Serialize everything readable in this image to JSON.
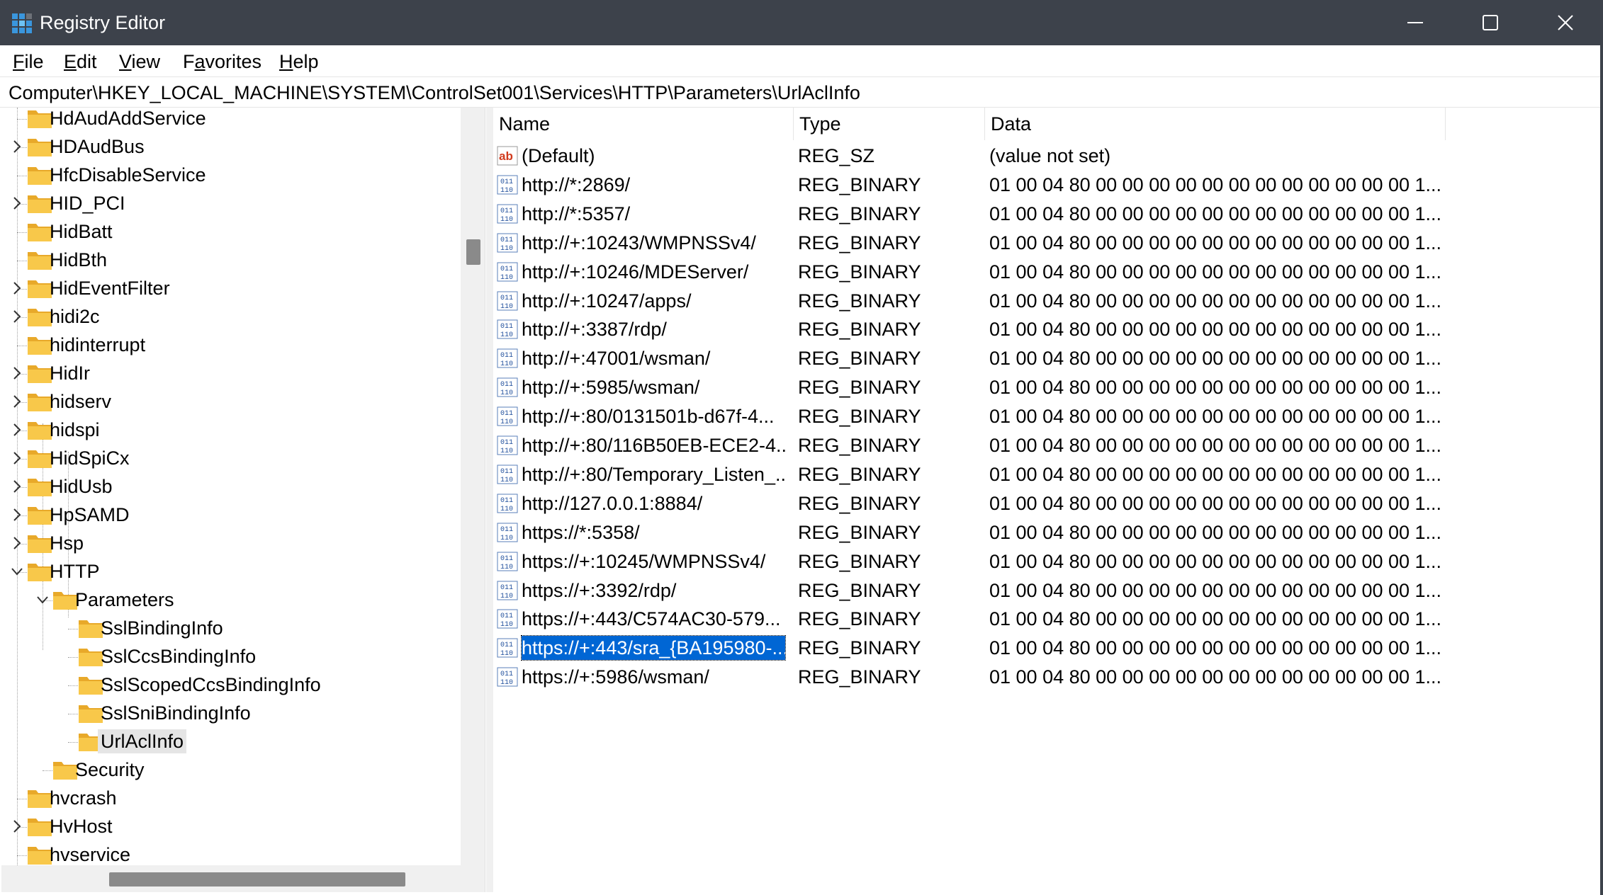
{
  "window": {
    "title": "Registry Editor"
  },
  "menu": {
    "file": {
      "u": "F",
      "rest": "ile"
    },
    "edit": {
      "u": "E",
      "rest": "dit"
    },
    "view": {
      "u": "V",
      "rest": "iew"
    },
    "favorites": {
      "pre": "F",
      "u": "a",
      "rest": "vorites"
    },
    "help": {
      "u": "H",
      "rest": "elp"
    }
  },
  "address": "Computer\\HKEY_LOCAL_MACHINE\\SYSTEM\\ControlSet001\\Services\\HTTP\\Parameters\\UrlAclInfo",
  "tree": [
    {
      "label": "HdAudAddService"
    },
    {
      "label": "HDAudBus"
    },
    {
      "label": "HfcDisableService"
    },
    {
      "label": "HID_PCI"
    },
    {
      "label": "HidBatt"
    },
    {
      "label": "HidBth"
    },
    {
      "label": "HidEventFilter"
    },
    {
      "label": "hidi2c"
    },
    {
      "label": "hidinterrupt"
    },
    {
      "label": "HidIr"
    },
    {
      "label": "hidserv"
    },
    {
      "label": "hidspi"
    },
    {
      "label": "HidSpiCx"
    },
    {
      "label": "HidUsb"
    },
    {
      "label": "HpSAMD"
    },
    {
      "label": "Hsp"
    },
    {
      "label": "HTTP"
    },
    {
      "label": "Parameters"
    },
    {
      "label": "SslBindingInfo"
    },
    {
      "label": "SslCcsBindingInfo"
    },
    {
      "label": "SslScopedCcsBindingInfo"
    },
    {
      "label": "SslSniBindingInfo"
    },
    {
      "label": "UrlAclInfo"
    },
    {
      "label": "Security"
    },
    {
      "label": "hvcrash"
    },
    {
      "label": "HvHost"
    },
    {
      "label": "hvservice"
    }
  ],
  "columns": {
    "name": "Name",
    "type": "Type",
    "data": "Data"
  },
  "values": [
    {
      "name": "(Default)",
      "type": "REG_SZ",
      "data": "(value not set)",
      "icon": "string-value-icon"
    },
    {
      "name": "http://*:2869/",
      "type": "REG_BINARY",
      "data": "01 00 04 80 00 00 00 00 00 00 00 00 00 00 00 00 1...",
      "icon": "binary-value-icon"
    },
    {
      "name": "http://*:5357/",
      "type": "REG_BINARY",
      "data": "01 00 04 80 00 00 00 00 00 00 00 00 00 00 00 00 1...",
      "icon": "binary-value-icon"
    },
    {
      "name": "http://+:10243/WMPNSSv4/",
      "type": "REG_BINARY",
      "data": "01 00 04 80 00 00 00 00 00 00 00 00 00 00 00 00 1...",
      "icon": "binary-value-icon"
    },
    {
      "name": "http://+:10246/MDEServer/",
      "type": "REG_BINARY",
      "data": "01 00 04 80 00 00 00 00 00 00 00 00 00 00 00 00 1...",
      "icon": "binary-value-icon"
    },
    {
      "name": "http://+:10247/apps/",
      "type": "REG_BINARY",
      "data": "01 00 04 80 00 00 00 00 00 00 00 00 00 00 00 00 1...",
      "icon": "binary-value-icon"
    },
    {
      "name": "http://+:3387/rdp/",
      "type": "REG_BINARY",
      "data": "01 00 04 80 00 00 00 00 00 00 00 00 00 00 00 00 1...",
      "icon": "binary-value-icon"
    },
    {
      "name": "http://+:47001/wsman/",
      "type": "REG_BINARY",
      "data": "01 00 04 80 00 00 00 00 00 00 00 00 00 00 00 00 1...",
      "icon": "binary-value-icon"
    },
    {
      "name": "http://+:5985/wsman/",
      "type": "REG_BINARY",
      "data": "01 00 04 80 00 00 00 00 00 00 00 00 00 00 00 00 1...",
      "icon": "binary-value-icon"
    },
    {
      "name": "http://+:80/0131501b-d67f-4...",
      "type": "REG_BINARY",
      "data": "01 00 04 80 00 00 00 00 00 00 00 00 00 00 00 00 1...",
      "icon": "binary-value-icon"
    },
    {
      "name": "http://+:80/116B50EB-ECE2-4...",
      "type": "REG_BINARY",
      "data": "01 00 04 80 00 00 00 00 00 00 00 00 00 00 00 00 1...",
      "icon": "binary-value-icon"
    },
    {
      "name": "http://+:80/Temporary_Listen_...",
      "type": "REG_BINARY",
      "data": "01 00 04 80 00 00 00 00 00 00 00 00 00 00 00 00 1...",
      "icon": "binary-value-icon"
    },
    {
      "name": "http://127.0.0.1:8884/",
      "type": "REG_BINARY",
      "data": "01 00 04 80 00 00 00 00 00 00 00 00 00 00 00 00 1...",
      "icon": "binary-value-icon"
    },
    {
      "name": "https://*:5358/",
      "type": "REG_BINARY",
      "data": "01 00 04 80 00 00 00 00 00 00 00 00 00 00 00 00 1...",
      "icon": "binary-value-icon"
    },
    {
      "name": "https://+:10245/WMPNSSv4/",
      "type": "REG_BINARY",
      "data": "01 00 04 80 00 00 00 00 00 00 00 00 00 00 00 00 1...",
      "icon": "binary-value-icon"
    },
    {
      "name": "https://+:3392/rdp/",
      "type": "REG_BINARY",
      "data": "01 00 04 80 00 00 00 00 00 00 00 00 00 00 00 00 1...",
      "icon": "binary-value-icon"
    },
    {
      "name": "https://+:443/C574AC30-579...",
      "type": "REG_BINARY",
      "data": "01 00 04 80 00 00 00 00 00 00 00 00 00 00 00 00 1...",
      "icon": "binary-value-icon"
    },
    {
      "name": "https://+:443/sra_{BA195980-...",
      "type": "REG_BINARY",
      "data": "01 00 04 80 00 00 00 00 00 00 00 00 00 00 00 00 1...",
      "icon": "binary-value-icon"
    },
    {
      "name": "https://+:5986/wsman/",
      "type": "REG_BINARY",
      "data": "01 00 04 80 00 00 00 00 00 00 00 00 00 00 00 00 1...",
      "icon": "binary-value-icon"
    }
  ],
  "colors": {
    "titlebar": "#3d424b",
    "selection": "#0066d4",
    "folder": "#f8c84a"
  }
}
